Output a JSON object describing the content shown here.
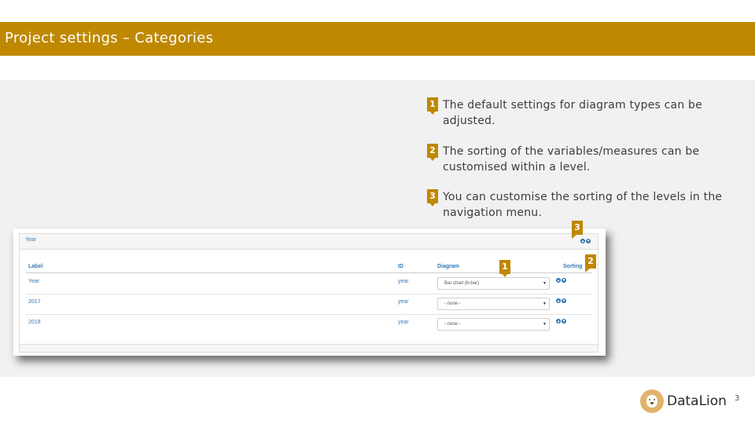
{
  "header": {
    "title": "Project settings – Categories",
    "bar_color": "#bf8800"
  },
  "notes": [
    {
      "marker": "1",
      "text": "The default settings for diagram types can be adjusted."
    },
    {
      "marker": "2",
      "text": "The sorting of the variables/measures can be customised within a level."
    },
    {
      "marker": "3",
      "text": "You can customise the sorting of the levels in the navigation menu."
    }
  ],
  "screenshot": {
    "panel_title": "Year",
    "columns": {
      "label": "Label",
      "id": "ID",
      "diagram": "Diagram",
      "sorting": "Sorting"
    },
    "rows": [
      {
        "label": "Year",
        "id": "year",
        "diagram": "Bar chart (b-bar)"
      },
      {
        "label": "2017",
        "id": "year",
        "diagram": "- none -"
      },
      {
        "label": "2018",
        "id": "year",
        "diagram": "- none -"
      }
    ],
    "callouts": [
      "1",
      "2",
      "3"
    ]
  },
  "footer": {
    "brand": "DataLion",
    "logo_icon": "lion-logo-icon",
    "page_number": "3"
  }
}
